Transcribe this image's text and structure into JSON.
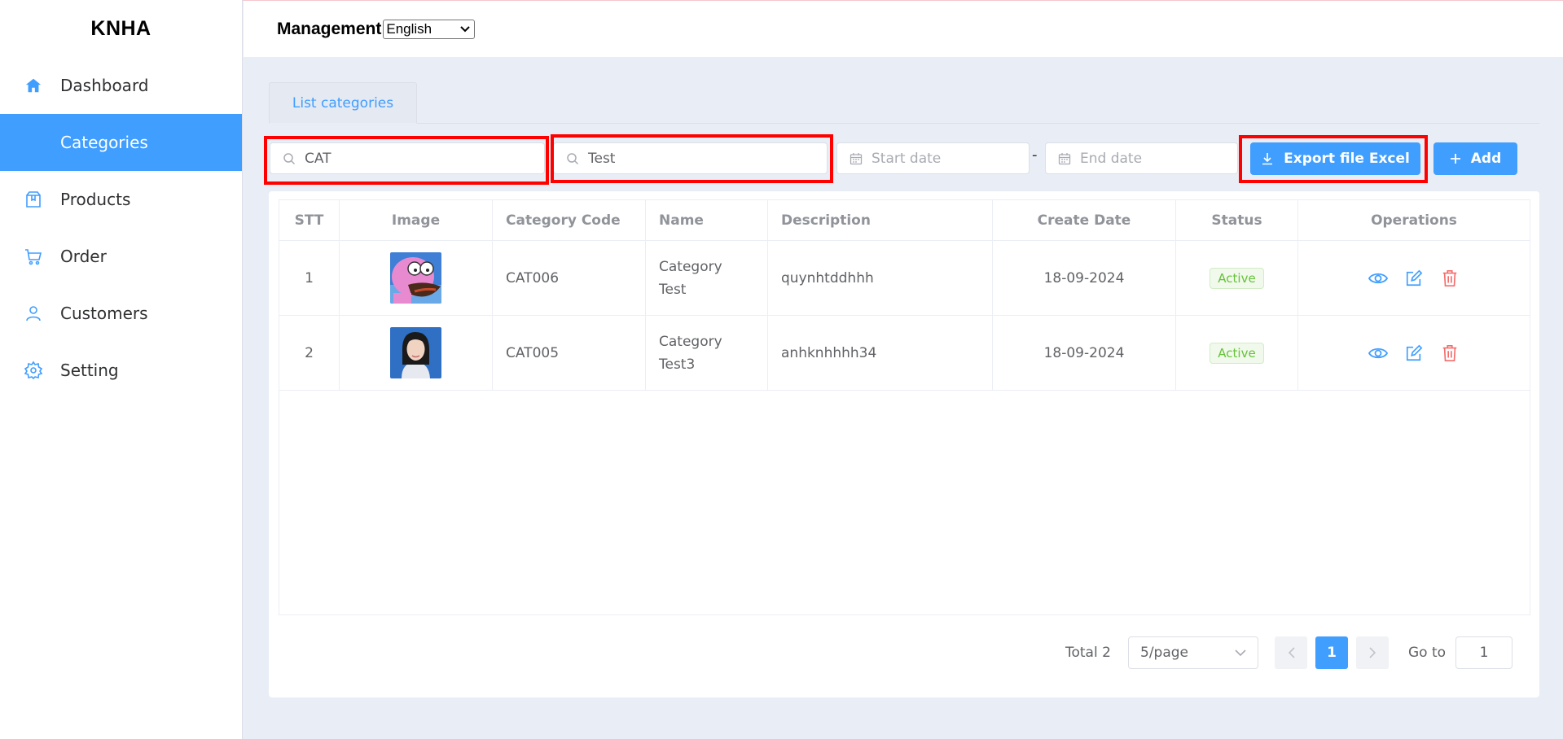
{
  "app": {
    "logo": "KNHA"
  },
  "sidebar": {
    "items": [
      {
        "label": "Dashboard",
        "icon": "home-icon"
      },
      {
        "label": "Categories",
        "icon": "none",
        "active": true
      },
      {
        "label": "Products",
        "icon": "package-icon"
      },
      {
        "label": "Order",
        "icon": "cart-icon"
      },
      {
        "label": "Customers",
        "icon": "user-icon"
      },
      {
        "label": "Setting",
        "icon": "gear-icon"
      }
    ]
  },
  "header": {
    "title": "Management",
    "language": "English"
  },
  "tabs": [
    {
      "label": "List categories"
    }
  ],
  "filters": {
    "code_value": "CAT",
    "name_value": "Test",
    "start_date_placeholder": "Start date",
    "end_date_placeholder": "End date",
    "date_separator": "-",
    "export_label": "Export file Excel",
    "add_label": "Add"
  },
  "table": {
    "headers": [
      "STT",
      "Image",
      "Category Code",
      "Name",
      "Description",
      "Create Date",
      "Status",
      "Operations"
    ],
    "rows": [
      {
        "stt": "1",
        "image": "cartoon-thumbnail",
        "code": "CAT006",
        "name_line1": "Category",
        "name_line2": "Test",
        "description": "quynhtddhhh",
        "date": "18-09-2024",
        "status": "Active"
      },
      {
        "stt": "2",
        "image": "portrait-thumbnail",
        "code": "CAT005",
        "name_line1": "Category",
        "name_line2": "Test3",
        "description": "anhknhhhh34",
        "date": "18-09-2024",
        "status": "Active"
      }
    ]
  },
  "pagination": {
    "total": "Total 2",
    "page_size": "5/page",
    "current_page": "1",
    "goto_label": "Go to",
    "goto_value": "1"
  },
  "colors": {
    "primary": "#409eff",
    "active_badge": "#67c23a",
    "delete": "#f56c6c",
    "highlight": "#ff0000"
  }
}
